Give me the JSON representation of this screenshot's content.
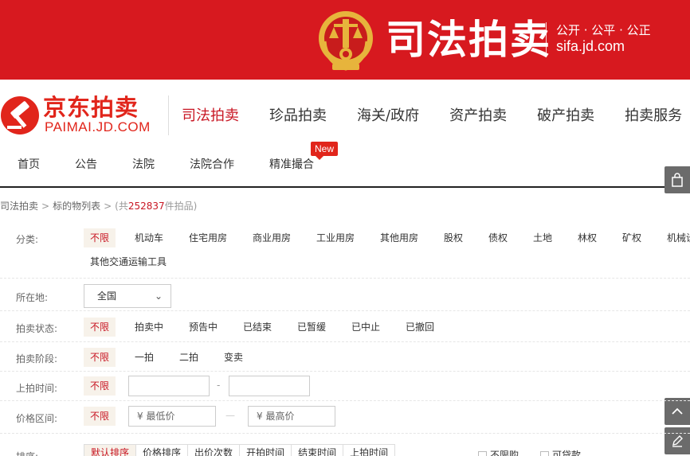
{
  "banner": {
    "title": "司法拍卖",
    "slogan": "公开 · 公平 · 公正",
    "url": "sifa.jd.com"
  },
  "logo": {
    "cn": "京东拍卖",
    "en": "PAIMAI.JD.COM"
  },
  "main_nav": [
    "司法拍卖",
    "珍品拍卖",
    "海关/政府",
    "资产拍卖",
    "破产拍卖",
    "拍卖服务"
  ],
  "sub_nav": {
    "items": [
      "首页",
      "公告",
      "法院",
      "法院合作",
      "精准撮合"
    ],
    "badge": "New"
  },
  "breadcrumb": {
    "root": "司法拍卖",
    "page": "标的物列表",
    "count_prefix": "(共",
    "count": "252837",
    "count_suffix": "件拍品)"
  },
  "filters": {
    "category": {
      "label": "分类:",
      "options": [
        "不限",
        "机动车",
        "住宅用房",
        "商业用房",
        "工业用房",
        "其他用房",
        "股权",
        "债权",
        "土地",
        "林权",
        "矿权",
        "机械设",
        "其他交通运输工具"
      ]
    },
    "location": {
      "label": "所在地:",
      "value": "全国"
    },
    "status": {
      "label": "拍卖状态:",
      "options": [
        "不限",
        "拍卖中",
        "预告中",
        "已结束",
        "已暂缓",
        "已中止",
        "已撤回"
      ]
    },
    "stage": {
      "label": "拍卖阶段:",
      "options": [
        "不限",
        "一拍",
        "二拍",
        "变卖"
      ]
    },
    "time": {
      "label": "上拍时间:",
      "any": "不限",
      "sep": "-"
    },
    "price": {
      "label": "价格区间:",
      "any": "不限",
      "min_placeholder": "¥ 最低价",
      "max_placeholder": "¥ 最高价",
      "sep": "—"
    },
    "sort": {
      "label": "排序:",
      "options": [
        "默认排序",
        "价格排序",
        "出价次数",
        "开拍时间",
        "结束时间",
        "上拍时间"
      ],
      "checks": [
        "不限购",
        "可贷款"
      ]
    }
  },
  "colors": {
    "banner_red": "#d7191f",
    "brand_red": "#e1251b",
    "active_red": "#c81623"
  }
}
